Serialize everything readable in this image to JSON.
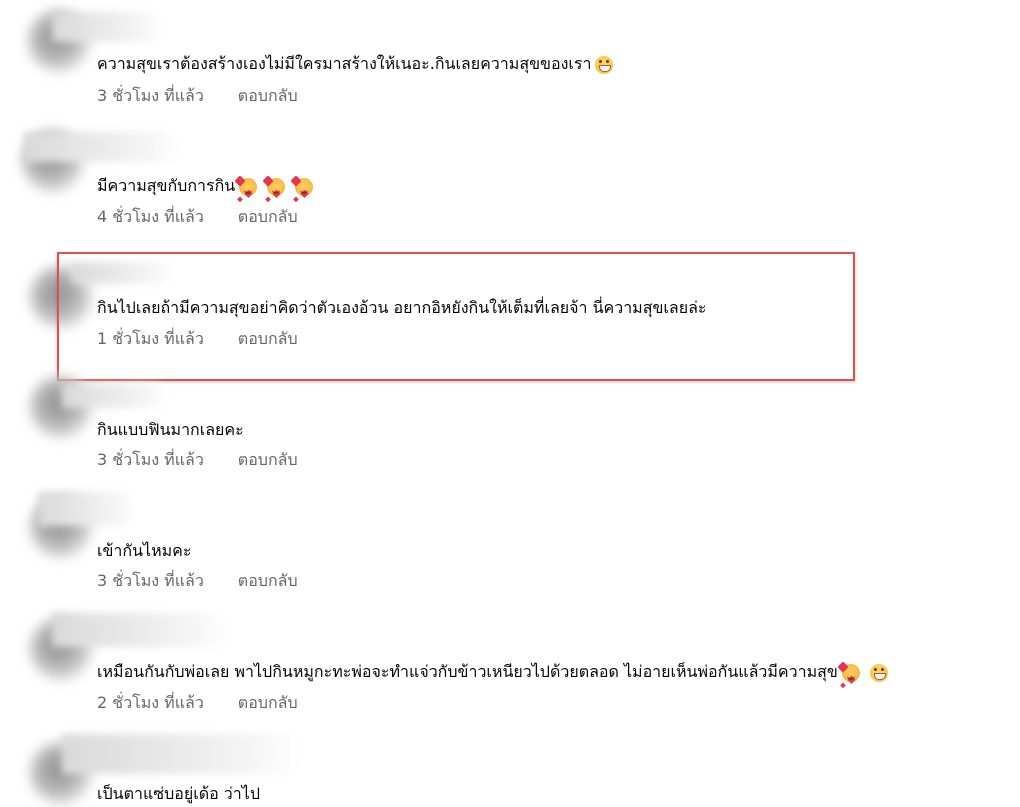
{
  "comments": [
    {
      "text": "ความสุขเราต้องสร้างเองไม่มีใครมาสร้างให้เนอะ.กินเลยความสุขของเรา",
      "emojis": [
        "grin"
      ],
      "time": "3 ชั่วโมง ที่แล้ว",
      "reply": "ตอบกลับ"
    },
    {
      "text": "มีความสุขกับการกิน",
      "emojis": [
        "hearts",
        "hearts",
        "hearts"
      ],
      "time": "4 ชั่วโมง ที่แล้ว",
      "reply": "ตอบกลับ"
    },
    {
      "text": "กินไปเลยถ้ามีความสุขอย่าคิดว่าตัวเองอ้วน อยากอิหยังกินให้เต็มที่เลยจ้า นี่ความสุขเลยล่ะ",
      "emojis": [],
      "time": "1 ชั่วโมง ที่แล้ว",
      "reply": "ตอบกลับ",
      "highlighted": true
    },
    {
      "text": "กินแบบฟินมากเลยคะ",
      "emojis": [],
      "time": "3 ชั่วโมง ที่แล้ว",
      "reply": "ตอบกลับ"
    },
    {
      "text": "เข้ากันไหมคะ",
      "emojis": [],
      "time": "3 ชั่วโมง ที่แล้ว",
      "reply": "ตอบกลับ"
    },
    {
      "text": "เหมือนกันกับพ่อเลย พาไปกินหมูกะทะพ่อจะทำแจ่วกับข้าวเหนียวไปด้วยตลอด ไม่อายเห็นพ่อกันแล้วมีความสุข",
      "emojis": [
        "hearts",
        "grin"
      ],
      "time": "2 ชั่วโมง ที่แล้ว",
      "reply": "ตอบกลับ"
    },
    {
      "text": "เป็นตาแซ่บอยู่เด้อ ว่าไป",
      "emojis": [],
      "time": "",
      "reply": ""
    }
  ],
  "colors": {
    "highlight_border": "#e0504f",
    "meta_text": "#65676b",
    "body_text": "#050505"
  }
}
